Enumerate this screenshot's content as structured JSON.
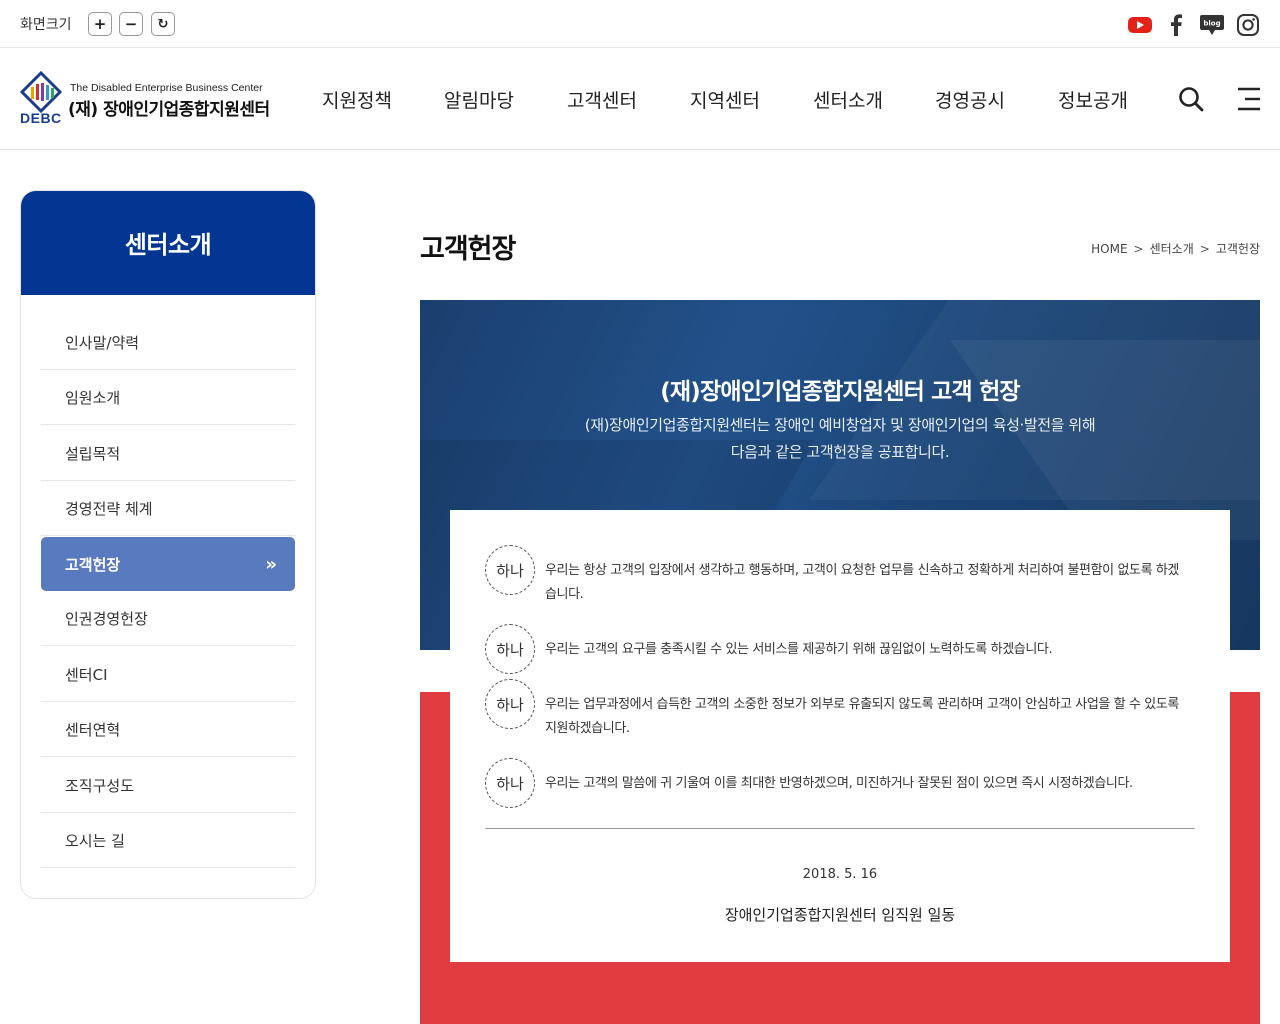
{
  "util": {
    "zoom_label": "화면크기",
    "zoom_in": "+",
    "zoom_out": "−",
    "zoom_reset": "↻",
    "blog_label": "blog"
  },
  "logo": {
    "en": "The Disabled Enterprise Business Center",
    "ko": "(재) 장애인기업종합지원센터",
    "abbr": "DEBC"
  },
  "gnb": [
    "지원정책",
    "알림마당",
    "고객센터",
    "지역센터",
    "센터소개",
    "경영공시",
    "정보공개"
  ],
  "sidebar": {
    "title": "센터소개",
    "items": [
      {
        "label": "인사말/약력"
      },
      {
        "label": "임원소개"
      },
      {
        "label": "설립목적"
      },
      {
        "label": "경영전략 체계"
      },
      {
        "label": "고객헌장",
        "active": true,
        "arrow": "»"
      },
      {
        "label": "인권경영헌장"
      },
      {
        "label": "센터CI"
      },
      {
        "label": "센터연혁"
      },
      {
        "label": "조직구성도"
      },
      {
        "label": "오시는 길"
      }
    ]
  },
  "page": {
    "title": "고객헌장",
    "breadcrumb": [
      "HOME",
      "센터소개",
      "고객헌장"
    ],
    "breadcrumb_sep": ">"
  },
  "banner": {
    "title": "(재)장애인기업종합지원센터 고객 헌장",
    "desc_line1": "(재)장애인기업종합지원센터는 장애인 예비창업자 및 장애인기업의 육성·발전을 위해",
    "desc_line2": "다음과 같은 고객헌장을 공표합니다."
  },
  "charter": {
    "items": [
      {
        "badge": "하나",
        "text": "우리는 항상 고객의 입장에서 생각하고 행동하며, 고객이 요청한 업무를 신속하고 정확하게 처리하여 불편함이 없도록 하겠습니다."
      },
      {
        "badge": "하나",
        "text": "우리는 고객의 요구를 충족시킬 수 있는 서비스를 제공하기 위해 끊임없이 노력하도록 하겠습니다."
      },
      {
        "badge": "하나",
        "text": "우리는 업무과정에서 습득한 고객의 소중한 정보가 외부로 유출되지 않도록 관리하며 고객이 안심하고 사업을 할 수 있도록 지원하겠습니다."
      },
      {
        "badge": "하나",
        "text": "우리는 고객의 말씀에 귀 기울여 이를 최대한 반영하겠으며, 미진하거나 잘못된 점이 있으면 즉시 시정하겠습니다."
      }
    ],
    "date": "2018. 5. 16",
    "signature": "장애인기업종합지원센터 임직원 일동"
  },
  "colors": {
    "brand_navy": "#033692",
    "active_menu": "#5a7ac0",
    "banner_blue": "#1f4a80",
    "red_band": "#e13c3f",
    "youtube_red": "#e62117"
  },
  "icons": [
    "youtube-icon",
    "facebook-icon",
    "blog-icon",
    "instagram-icon",
    "search-icon",
    "menu-icon"
  ]
}
